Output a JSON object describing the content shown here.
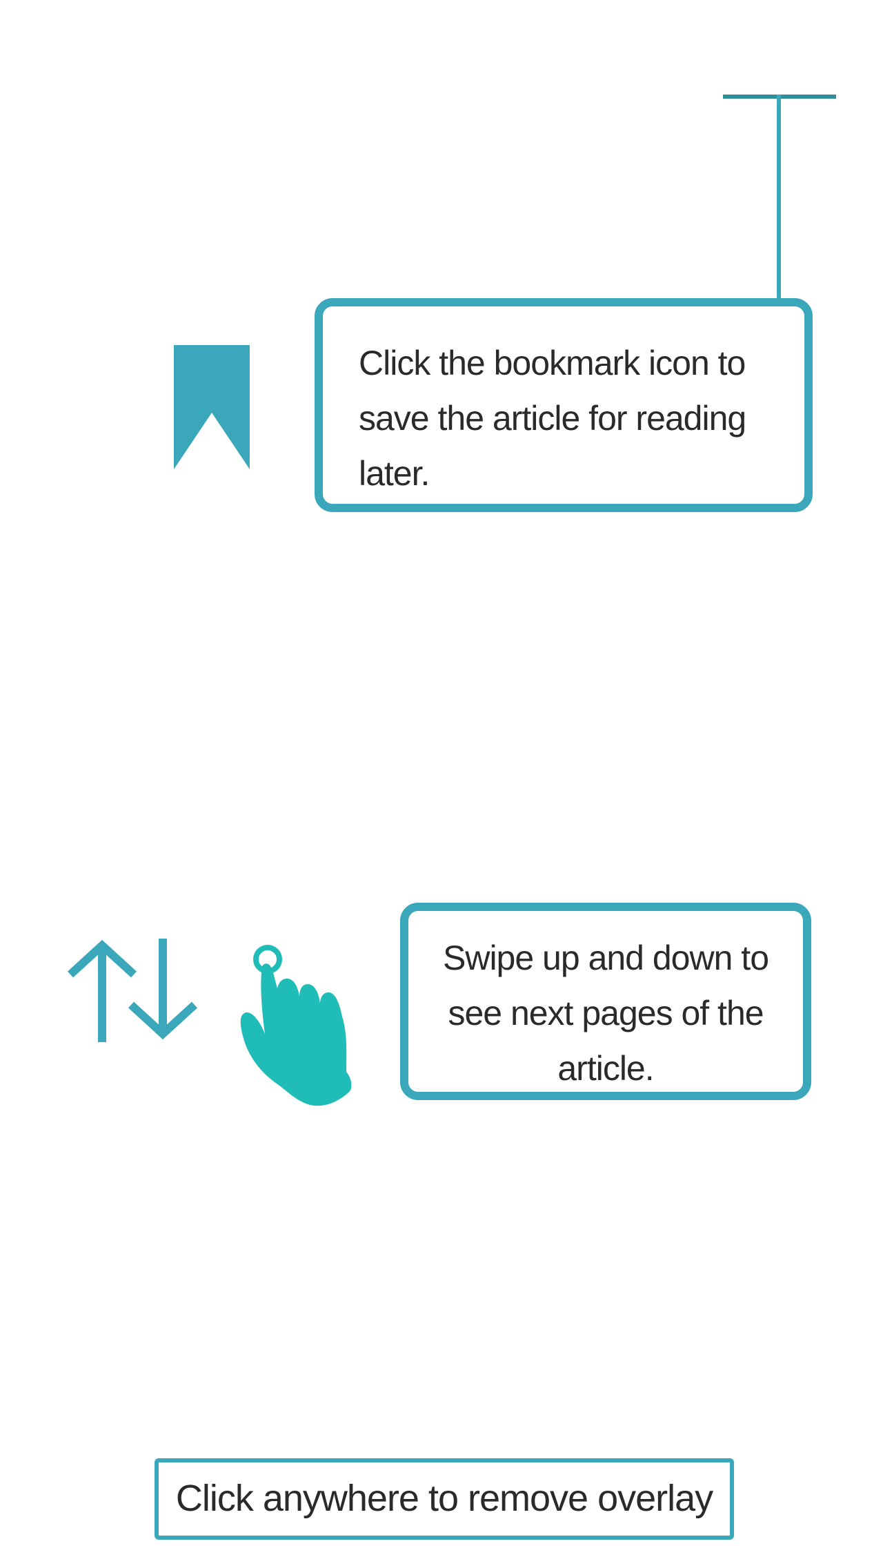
{
  "colors": {
    "accent": "#3ba7ba",
    "accent_dark": "#2e8f99",
    "hand": "#1fbcb8",
    "text": "#2a2a2a",
    "background": "#ffffff"
  },
  "icons": {
    "bookmark": "bookmark-icon",
    "arrows": "swipe-arrows-icon",
    "hand": "tap-hand-icon"
  },
  "tips": {
    "bookmark": "Click the bookmark icon to save the article for reading later.",
    "swipe": "Swipe up and down to see next pages of the article."
  },
  "dismiss": {
    "label": "Click anywhere to remove overlay"
  }
}
